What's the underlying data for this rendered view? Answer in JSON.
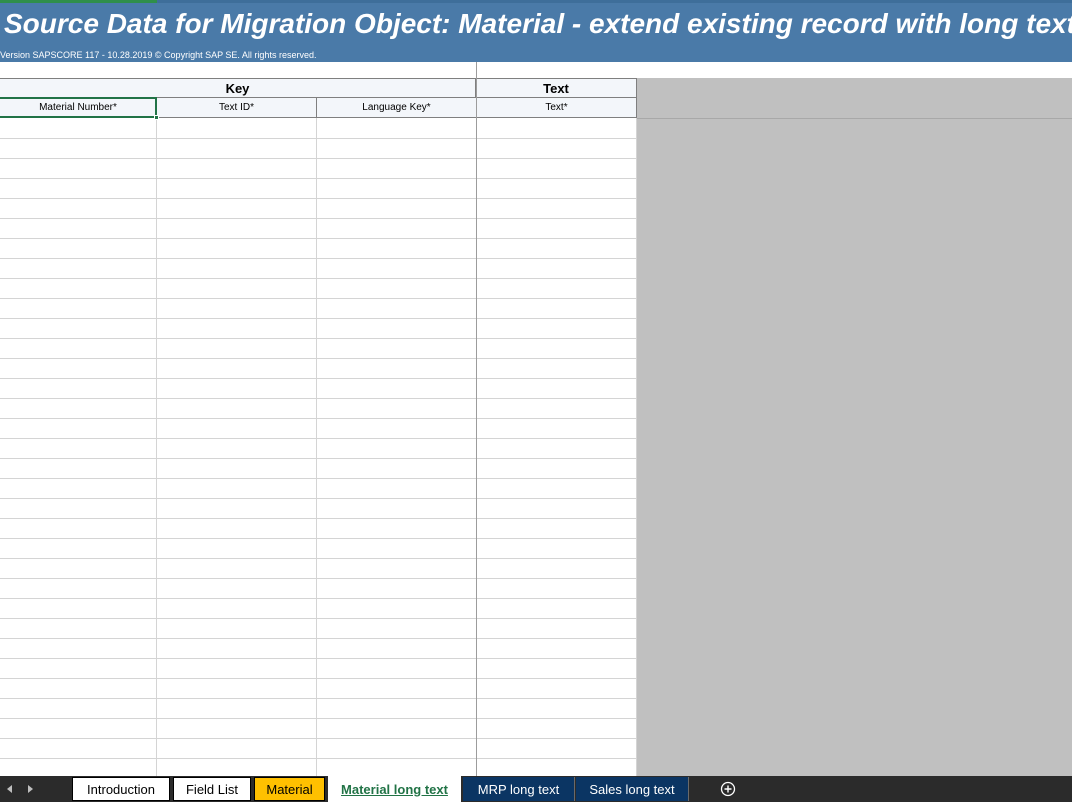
{
  "banner": {
    "title": "Source Data for Migration Object:  Material - extend existing record with long text",
    "version": "Version SAPSCORE 117  - 10.28.2019 © Copyright SAP SE. All rights reserved.",
    "color": "#4a7aa8"
  },
  "headers": {
    "groups": [
      {
        "label": "Key"
      },
      {
        "label": "Text"
      }
    ],
    "columns": [
      {
        "label": "Material Number*"
      },
      {
        "label": "Text ID*"
      },
      {
        "label": "Language Key*"
      },
      {
        "label": "Text*"
      }
    ]
  },
  "tabs": {
    "items": [
      {
        "label": "Introduction",
        "style": "white"
      },
      {
        "label": "Field List",
        "style": "white"
      },
      {
        "label": "Material",
        "style": "yellow"
      },
      {
        "label": "Material long text",
        "style": "active"
      },
      {
        "label": "MRP long text",
        "style": "navy"
      },
      {
        "label": "Sales long text",
        "style": "navy"
      }
    ],
    "nav_prev_icon": "triangle-left-icon",
    "nav_next_icon": "triangle-right-icon",
    "add_icon": "plus-circle-icon"
  },
  "colors": {
    "active_tab_text": "#217346",
    "selection": "#217346",
    "yellow_tab": "#ffc000",
    "navy_tab": "#0b3563",
    "sheet_background": "#c0c0c0"
  }
}
